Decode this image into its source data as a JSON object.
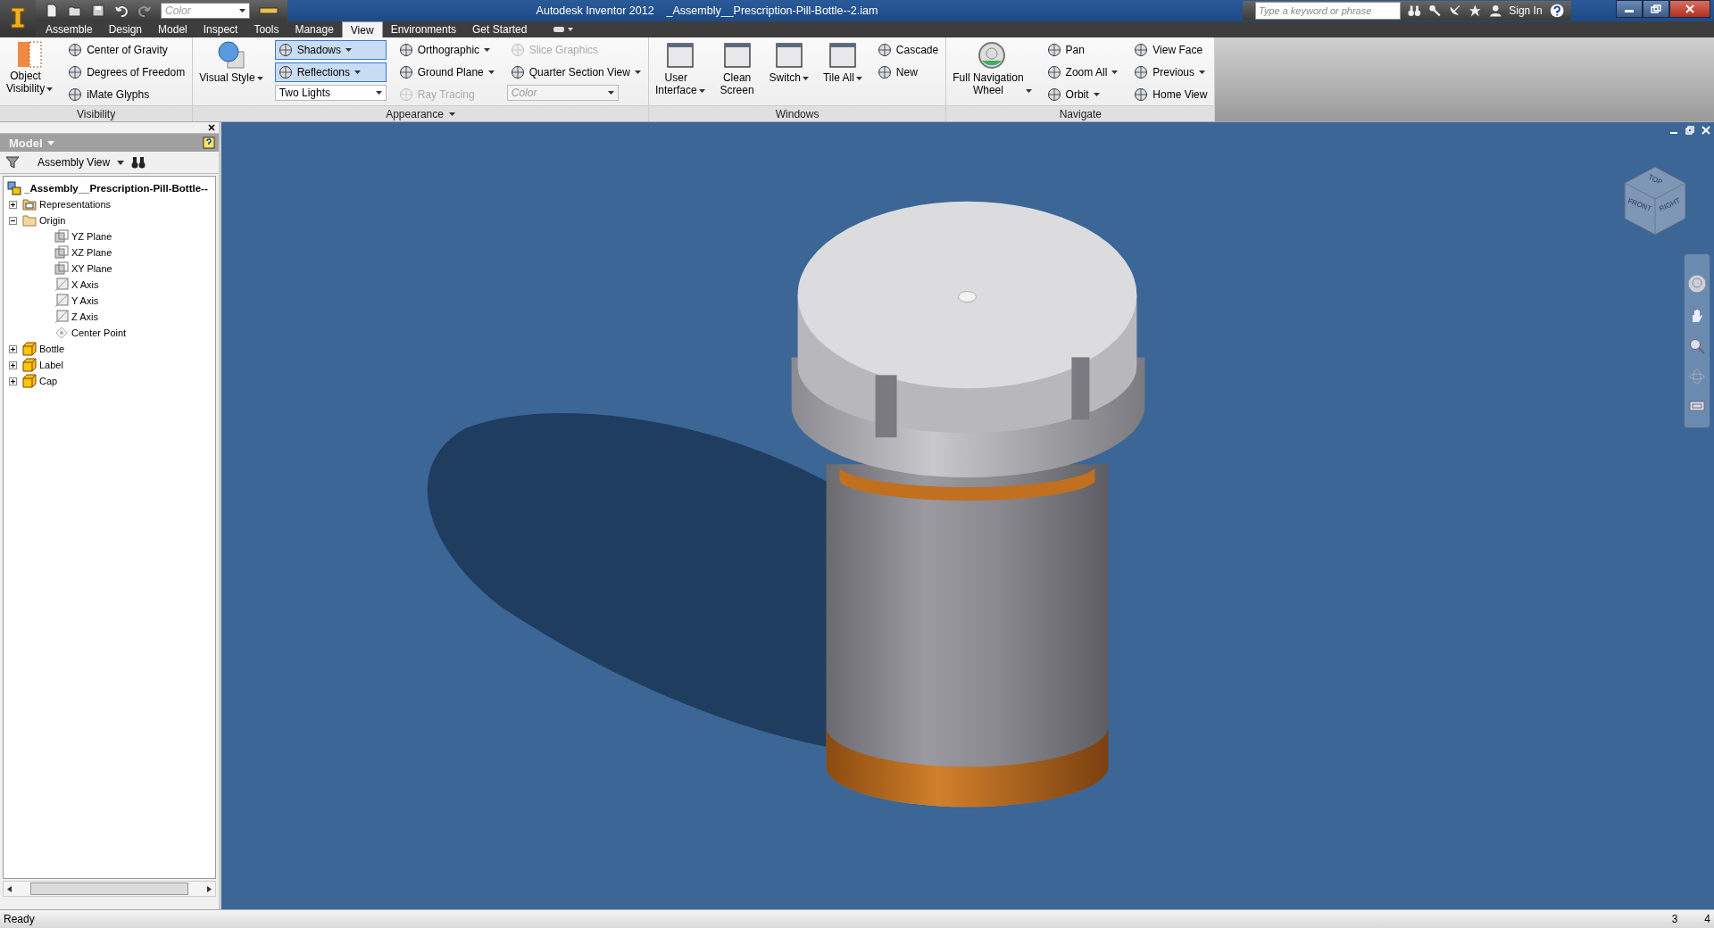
{
  "quick_access": {
    "style_field": "Color"
  },
  "title_bar": {
    "app": "Autodesk Inventor 2012",
    "document": "_Assembly__Prescription-Pill-Bottle--2.iam"
  },
  "search": {
    "placeholder": "Type a keyword or phrase"
  },
  "sign_in": "Sign In",
  "tabs": [
    {
      "label": "Assemble",
      "selected": false
    },
    {
      "label": "Design",
      "selected": false
    },
    {
      "label": "Model",
      "selected": false
    },
    {
      "label": "Inspect",
      "selected": false
    },
    {
      "label": "Tools",
      "selected": false
    },
    {
      "label": "Manage",
      "selected": false
    },
    {
      "label": "View",
      "selected": true
    },
    {
      "label": "Environments",
      "selected": false
    },
    {
      "label": "Get Started",
      "selected": false
    }
  ],
  "ribbon": {
    "panels": [
      {
        "title": "Visibility",
        "has_menu": false,
        "columns": [
          [
            {
              "kind": "large",
              "label": "Object\nVisibility",
              "menu": true
            }
          ],
          [
            {
              "kind": "small",
              "label": "Center of Gravity",
              "menu": false,
              "on": false,
              "disabled": false
            },
            {
              "kind": "small",
              "label": "Degrees of Freedom",
              "menu": false,
              "on": false,
              "disabled": false
            },
            {
              "kind": "small",
              "label": "iMate Glyphs",
              "menu": false,
              "on": false,
              "disabled": false
            }
          ]
        ]
      },
      {
        "title": "Appearance",
        "has_menu": true,
        "columns": [
          [
            {
              "kind": "large",
              "label": "Visual Style",
              "menu": true
            }
          ],
          [
            {
              "kind": "small",
              "label": "Shadows",
              "menu": true,
              "on": true,
              "disabled": false
            },
            {
              "kind": "small",
              "label": "Reflections",
              "menu": true,
              "on": true,
              "disabled": false
            },
            {
              "kind": "dropdown",
              "label": "Two Lights",
              "disabled": false
            }
          ],
          [
            {
              "kind": "small",
              "label": "Orthographic",
              "menu": true,
              "on": false,
              "disabled": false
            },
            {
              "kind": "small",
              "label": "Ground Plane",
              "menu": true,
              "on": false,
              "disabled": false
            },
            {
              "kind": "small",
              "label": "Ray Tracing",
              "menu": false,
              "on": false,
              "disabled": true
            }
          ],
          [
            {
              "kind": "small",
              "label": "Slice Graphics",
              "menu": false,
              "on": false,
              "disabled": true
            },
            {
              "kind": "small",
              "label": "Quarter Section View",
              "menu": true,
              "on": false,
              "disabled": false
            },
            {
              "kind": "dropdown",
              "label": "Color",
              "disabled": true
            }
          ]
        ]
      },
      {
        "title": "Windows",
        "has_menu": false,
        "columns": [
          [
            {
              "kind": "large",
              "label": "User\nInterface",
              "menu": true
            }
          ],
          [
            {
              "kind": "large",
              "label": "Clean\nScreen",
              "menu": false
            }
          ],
          [
            {
              "kind": "large",
              "label": "Switch",
              "menu": true
            }
          ],
          [
            {
              "kind": "large",
              "label": "Tile All",
              "menu": true
            }
          ],
          [
            {
              "kind": "small",
              "label": "Cascade",
              "menu": false,
              "on": false,
              "disabled": false
            },
            {
              "kind": "small",
              "label": "New",
              "menu": false,
              "on": false,
              "disabled": false
            }
          ]
        ]
      },
      {
        "title": "Navigate",
        "has_menu": false,
        "columns": [
          [
            {
              "kind": "large",
              "label": "Full Navigation\nWheel",
              "menu": true
            }
          ],
          [
            {
              "kind": "small",
              "label": "Pan",
              "menu": false,
              "on": false,
              "disabled": false
            },
            {
              "kind": "small",
              "label": "Zoom All",
              "menu": true,
              "on": false,
              "disabled": false
            },
            {
              "kind": "small",
              "label": "Orbit",
              "menu": true,
              "on": false,
              "disabled": false
            }
          ],
          [
            {
              "kind": "small",
              "label": "View Face",
              "menu": false,
              "on": false,
              "disabled": false
            },
            {
              "kind": "small",
              "label": "Previous",
              "menu": true,
              "on": false,
              "disabled": false
            },
            {
              "kind": "small",
              "label": "Home View",
              "menu": false,
              "on": false,
              "disabled": false
            }
          ]
        ]
      }
    ]
  },
  "browser": {
    "title": "Model",
    "view": "Assembly View",
    "tree": [
      {
        "label": "_Assembly__Prescription-Pill-Bottle--",
        "kind": "assembly",
        "children": [
          {
            "label": "Representations",
            "kind": "representations",
            "expanded": false
          },
          {
            "label": "Origin",
            "kind": "folder",
            "expanded": true,
            "children": [
              {
                "label": "YZ Plane",
                "kind": "plane"
              },
              {
                "label": "XZ Plane",
                "kind": "plane"
              },
              {
                "label": "XY Plane",
                "kind": "plane"
              },
              {
                "label": "X Axis",
                "kind": "axis"
              },
              {
                "label": "Y Axis",
                "kind": "axis"
              },
              {
                "label": "Z Axis",
                "kind": "axis"
              },
              {
                "label": "Center Point",
                "kind": "point"
              }
            ]
          },
          {
            "label": "Bottle",
            "kind": "part",
            "expanded": false
          },
          {
            "label": "Label",
            "kind": "part",
            "expanded": false
          },
          {
            "label": "Cap",
            "kind": "part",
            "expanded": false
          }
        ]
      }
    ]
  },
  "viewcube": {
    "top": "TOP",
    "front": "FRONT",
    "right": "RIGHT"
  },
  "status_bar": {
    "message": "Ready",
    "count_1": "3",
    "count_2": "4"
  }
}
